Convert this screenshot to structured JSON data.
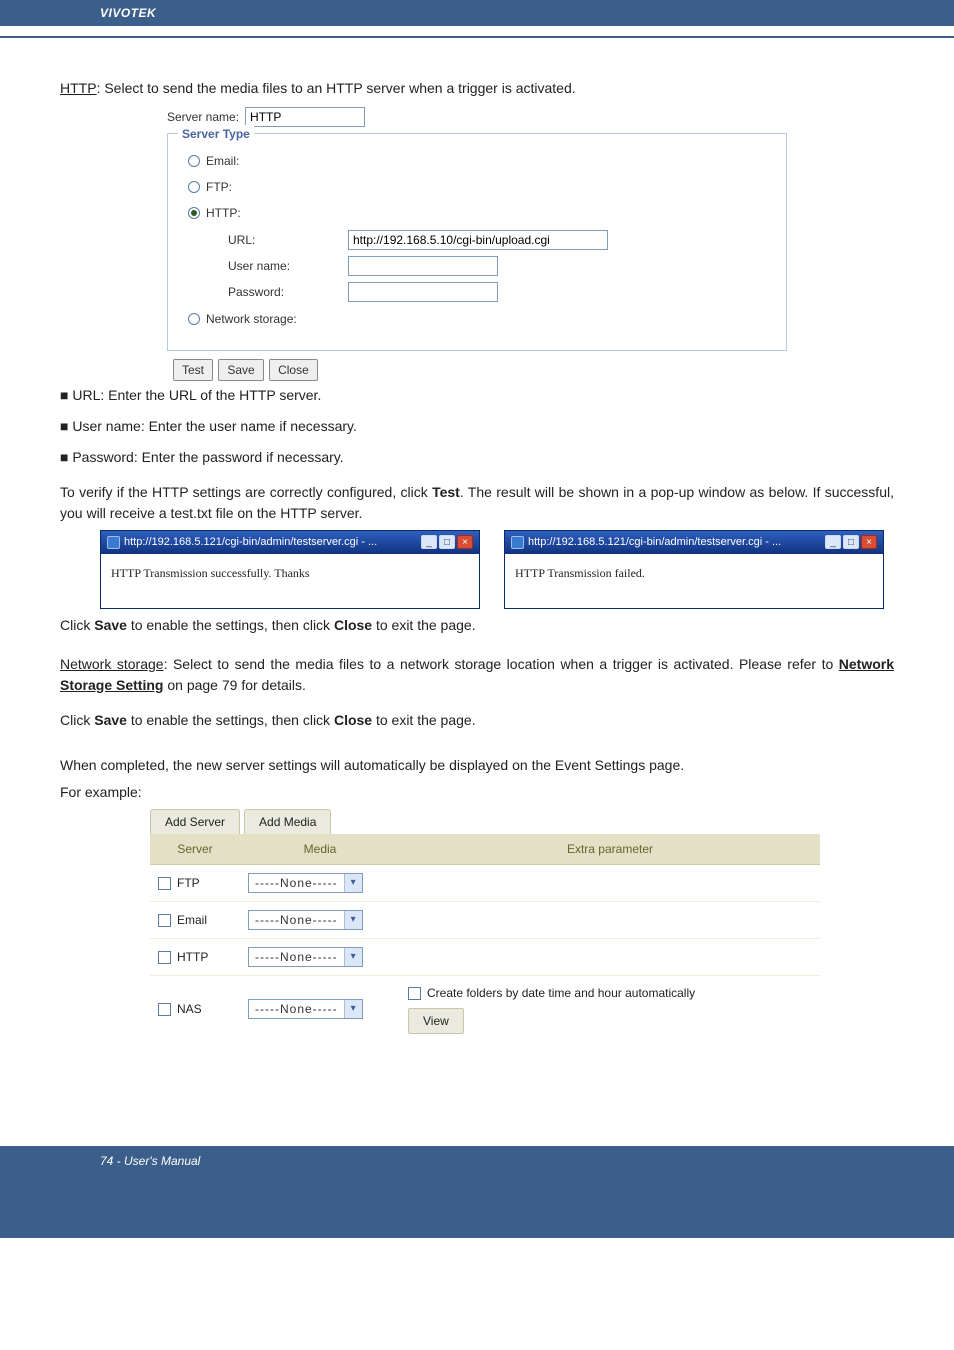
{
  "header": {
    "brand": "VIVOTEK"
  },
  "intro_http": {
    "label": "HTTP",
    "text": ": Select to send the media files to an HTTP server when a trigger is activated."
  },
  "dialog": {
    "server_name_label": "Server name:",
    "server_name_value": "HTTP",
    "fieldset_title": "Server Type",
    "email_label": "Email:",
    "ftp_label": "FTP:",
    "http_label": "HTTP:",
    "url_label": "URL:",
    "url_value": "http://192.168.5.10/cgi-bin/upload.cgi",
    "username_label": "User name:",
    "password_label": "Password:",
    "ns_label": "Network storage:",
    "btn_test": "Test",
    "btn_save": "Save",
    "btn_close": "Close"
  },
  "bullets": {
    "url": "■ URL: Enter the URL of the HTTP server.",
    "user": "■ User name: Enter the user name if necessary.",
    "pass": "■ Password: Enter the password if necessary."
  },
  "verify_para": {
    "pre": "To verify if the HTTP settings are correctly configured, click ",
    "test_word": "Test",
    "post": ". The result will be shown in a pop-up window as below. If successful, you will receive a test.txt file on the HTTP server."
  },
  "popups": {
    "title_prefix": "http://192.168.5.121/cgi-bin/admin/testserver.cgi - ...",
    "success_body": "HTTP Transmission successfully. Thanks",
    "fail_body": "HTTP Transmission failed."
  },
  "save_line": {
    "pre": "Click ",
    "save": "Save",
    "mid": " to enable the settings, then click ",
    "close": "Close",
    "post": " to exit the page."
  },
  "ns_para": {
    "label": "Network storage",
    "text1": ": Select to send the media files to a network storage location when a trigger is activated. Please refer to ",
    "link": "Network Storage Setting",
    "text2": " on page 79 for details."
  },
  "completed_line": "When completed, the new server settings will automatically be displayed on the Event Settings page.",
  "for_example": "For example:",
  "table": {
    "tab_add_server": "Add Server",
    "tab_add_media": "Add Media",
    "col_server": "Server",
    "col_media": "Media",
    "col_extra": "Extra parameter",
    "none_label": "-----None-----",
    "rows": [
      {
        "name": "FTP"
      },
      {
        "name": "Email"
      },
      {
        "name": "HTTP"
      },
      {
        "name": "NAS"
      }
    ],
    "nas_extra": "Create folders by date time and hour automatically",
    "view_btn": "View"
  },
  "footer": {
    "text": "74 - User's Manual"
  }
}
